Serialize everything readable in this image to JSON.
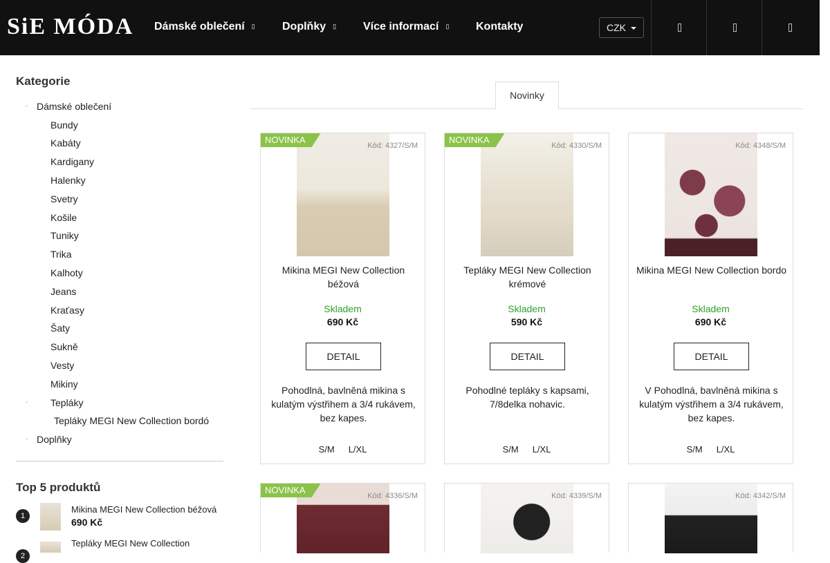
{
  "header": {
    "logo": "SiE MÓDA",
    "nav": [
      {
        "label": "Dámské oblečení",
        "has_dropdown": true
      },
      {
        "label": "Doplňky",
        "has_dropdown": true
      },
      {
        "label": "Více informací",
        "has_dropdown": true
      },
      {
        "label": "Kontakty",
        "has_dropdown": false
      }
    ],
    "currency": "CZK",
    "caret": "▯"
  },
  "sidebar": {
    "title": "Kategorie",
    "categories": [
      {
        "label": "Dámské oblečení",
        "level": 0
      },
      {
        "label": "Bundy",
        "level": 1
      },
      {
        "label": "Kabáty",
        "level": 1
      },
      {
        "label": "Kardigany",
        "level": 1
      },
      {
        "label": "Halenky",
        "level": 1
      },
      {
        "label": "Svetry",
        "level": 1
      },
      {
        "label": "Košile",
        "level": 1
      },
      {
        "label": "Tuniky",
        "level": 1
      },
      {
        "label": "Trika",
        "level": 1
      },
      {
        "label": "Kalhoty",
        "level": 1
      },
      {
        "label": "Jeans",
        "level": 1
      },
      {
        "label": "Kraťasy",
        "level": 1
      },
      {
        "label": "Šaty",
        "level": 1
      },
      {
        "label": "Sukně",
        "level": 1
      },
      {
        "label": "Vesty",
        "level": 1
      },
      {
        "label": "Mikiny",
        "level": 1
      },
      {
        "label": "Tepláky",
        "level": 1
      },
      {
        "label": "Tepláky MEGI New Collection bordó",
        "level": 2
      },
      {
        "label": "Doplňky",
        "level": 0
      }
    ],
    "top5_title": "Top 5 produktů",
    "top5": [
      {
        "rank": "1",
        "name": "Mikina MEGI New Collection béžová",
        "price": "690 Kč"
      },
      {
        "rank": "2",
        "name": "Tepláky MEGI New Collection",
        "price": ""
      }
    ]
  },
  "tabs": {
    "active": "Novinky"
  },
  "products": [
    {
      "badge": "NOVINKA",
      "code": "Kód: 4327/S/M",
      "name": "Mikina MEGI New Collection béžová",
      "stock": "Skladem",
      "price": "690 Kč",
      "detail": "DETAIL",
      "desc": "Pohodlná, bavlněná mikina s kulatým výstřihem a 3/4 rukávem, bez kapes.",
      "sizes": [
        "S/M",
        "L/XL"
      ]
    },
    {
      "badge": "NOVINKA",
      "code": "Kód: 4330/S/M",
      "name": "Tepláky MEGI New Collection krémové",
      "stock": "Skladem",
      "price": "590 Kč",
      "detail": "DETAIL",
      "desc": "Pohodlné tepláky s kapsami, 7/8delka nohavic.",
      "sizes": [
        "S/M",
        "L/XL"
      ]
    },
    {
      "badge": "",
      "code": "Kód: 4348/S/M",
      "name": "Mikina MEGI New Collection bordo",
      "stock": "Skladem",
      "price": "690 Kč",
      "detail": "DETAIL",
      "desc": "V Pohodlná, bavlněná mikina s kulatým výstřihem a 3/4 rukávem, bez kapes.",
      "sizes": [
        "S/M",
        "L/XL"
      ]
    },
    {
      "badge": "NOVINKA",
      "code": "Kód: 4336/S/M"
    },
    {
      "badge": "",
      "code": "Kód: 4339/S/M"
    },
    {
      "badge": "",
      "code": "Kód: 4342/S/M"
    }
  ]
}
